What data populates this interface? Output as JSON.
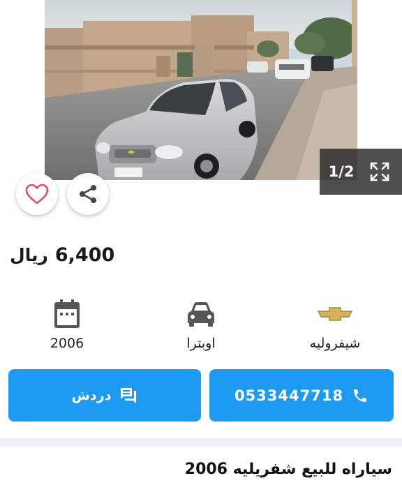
{
  "gallery": {
    "counter": "1/2",
    "icons": {
      "prev": "chevron-left-icon",
      "next": "chevron-right-icon",
      "expand": "expand-icon"
    }
  },
  "actions_top": {
    "favorite_icon": "heart-icon",
    "share_icon": "share-icon"
  },
  "price": {
    "value": "6,400",
    "currency": "ريال"
  },
  "specs": {
    "brand": {
      "label": "شيفروليه",
      "icon": "chevrolet-logo-icon"
    },
    "model": {
      "label": "اوبترا",
      "icon": "car-icon"
    },
    "year": {
      "label": "2006",
      "icon": "calendar-icon"
    }
  },
  "buttons": {
    "call_label": "0533447718",
    "call_icon": "phone-icon",
    "chat_label": "دردش",
    "chat_icon": "chat-icon"
  },
  "ad": {
    "title": "سياراه للبيع شفريليه 2006"
  },
  "colors": {
    "primary": "#1e9af3",
    "heart": "#e24a6a",
    "separator": "#eef0f5"
  }
}
